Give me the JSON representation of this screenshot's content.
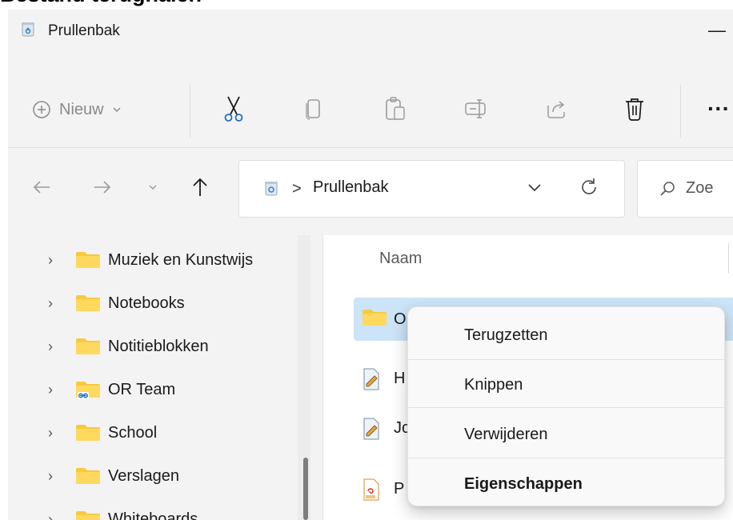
{
  "heading": "Bestand terughalen",
  "window": {
    "title": "Prullenbak",
    "minimize_glyph": "—"
  },
  "toolbar": {
    "new_label": "Nieuw",
    "more_glyph": "···"
  },
  "address": {
    "path_sep": ">",
    "location": "Prullenbak",
    "search_placeholder": "Zoe"
  },
  "sidebar": {
    "items": [
      {
        "label": "Muziek en Kunstwijs",
        "icon": "folder-icon"
      },
      {
        "label": "Notebooks",
        "icon": "folder-icon"
      },
      {
        "label": "Notitieblokken",
        "icon": "folder-icon"
      },
      {
        "label": "OR Team",
        "icon": "shared-folder-icon"
      },
      {
        "label": "School",
        "icon": "folder-icon"
      },
      {
        "label": "Verslagen",
        "icon": "folder-icon"
      },
      {
        "label": "Whiteboards",
        "icon": "folder-icon"
      }
    ]
  },
  "content": {
    "column_name": "Naam",
    "rows": [
      {
        "label": "O",
        "icon": "folder-icon",
        "selected": true
      },
      {
        "label": "H",
        "icon": "document-icon"
      },
      {
        "label": "Jc",
        "icon": "document-icon"
      },
      {
        "label": "P",
        "icon": "pdf-icon"
      }
    ]
  },
  "context_menu": {
    "items": [
      {
        "label": "Terugzetten"
      },
      {
        "label": "Knippen"
      },
      {
        "label": "Verwijderen"
      },
      {
        "label": "Eigenschappen",
        "bold": true
      }
    ]
  },
  "colors": {
    "selection": "#cce4f7",
    "folder": "#f8c93f",
    "accent": "#1f6fbf"
  }
}
